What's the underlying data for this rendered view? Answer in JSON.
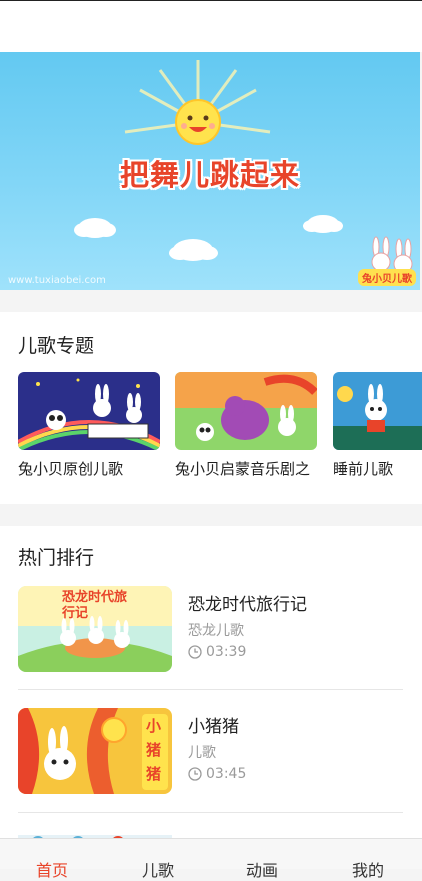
{
  "banner": {
    "title": "把舞儿跳起来",
    "watermark": "www.tuxiaobei.com",
    "logo_text": "兔小贝儿歌"
  },
  "topics": {
    "heading": "儿歌专题",
    "items": [
      {
        "label": "兔小贝原创儿歌"
      },
      {
        "label": "兔小贝启蒙音乐剧之"
      },
      {
        "label": "睡前儿歌"
      }
    ]
  },
  "ranking": {
    "heading": "热门排行",
    "items": [
      {
        "title": "恐龙时代旅行记",
        "subtitle": "恐龙儿歌",
        "duration": "03:39",
        "thumb_text": "恐龙时代旅行记"
      },
      {
        "title": "小猪猪",
        "subtitle": "儿歌",
        "duration": "03:45",
        "thumb_text": "小猪猪"
      }
    ]
  },
  "tabbar": {
    "items": [
      {
        "label": "首页",
        "active": true
      },
      {
        "label": "儿歌",
        "active": false
      },
      {
        "label": "动画",
        "active": false
      },
      {
        "label": "我的",
        "active": false
      }
    ],
    "active_color": "#e8442a"
  },
  "colors": {
    "banner_sky": "#78d2f5",
    "title_red": "#e8442a"
  }
}
